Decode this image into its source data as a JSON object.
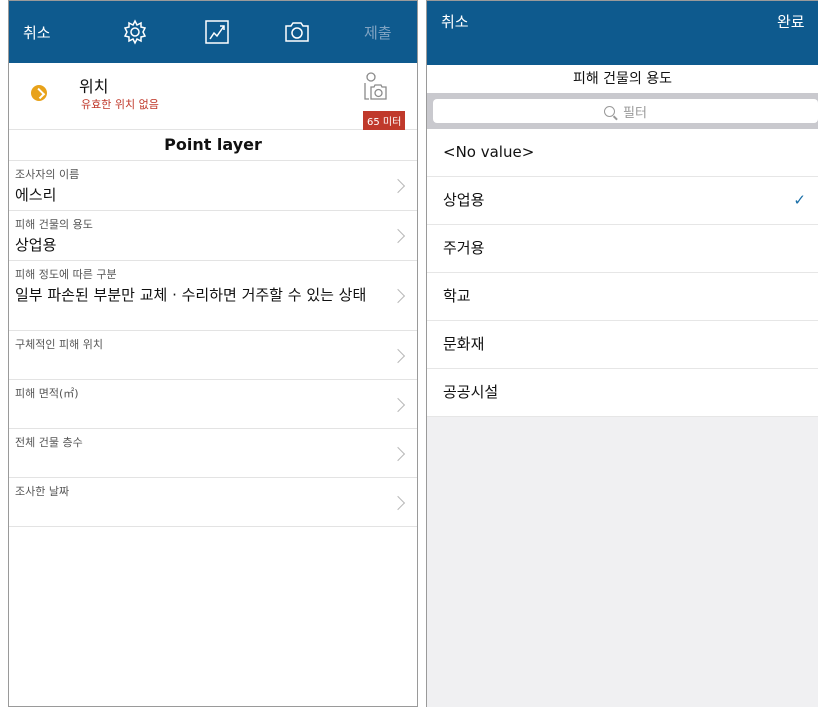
{
  "left": {
    "header": {
      "cancel": "취소",
      "submit": "제출"
    },
    "location": {
      "title": "위치",
      "subtitle": "유효한 위치 없음",
      "distance": "65 미터"
    },
    "layer_title": "Point layer",
    "fields": [
      {
        "label": "조사자의 이름",
        "value": "에스리"
      },
      {
        "label": "피해 건물의 용도",
        "value": "상업용"
      },
      {
        "label": "피해 정도에 따른 구분",
        "value": "일부 파손된 부분만 교체 · 수리하면 거주할 수 있는 상태"
      },
      {
        "label": "구체적인 피해 위치",
        "value": ""
      },
      {
        "label": "피해 면적(㎡)",
        "value": ""
      },
      {
        "label": "전체 건물 층수",
        "value": ""
      },
      {
        "label": "조사한 날짜",
        "value": ""
      }
    ]
  },
  "right": {
    "header": {
      "cancel": "취소",
      "done": "완료"
    },
    "subtitle": "피해 건물의 용도",
    "search": {
      "placeholder": "필터"
    },
    "options": [
      {
        "label": "<No value>",
        "selected": false
      },
      {
        "label": "상업용",
        "selected": true
      },
      {
        "label": "주거용",
        "selected": false
      },
      {
        "label": "학교",
        "selected": false
      },
      {
        "label": "문화재",
        "selected": false
      },
      {
        "label": "공공시설",
        "selected": false
      }
    ]
  },
  "icons": [
    "gear-icon",
    "sketch-icon",
    "camera-icon",
    "location-status-icon",
    "camera-location-icon",
    "search-icon",
    "chevron-right-icon",
    "checkmark-icon"
  ],
  "colors": {
    "header": "#0e5a8e",
    "warning": "#c0392b",
    "location_dot": "#e8a21a",
    "check": "#1a6fa8"
  }
}
